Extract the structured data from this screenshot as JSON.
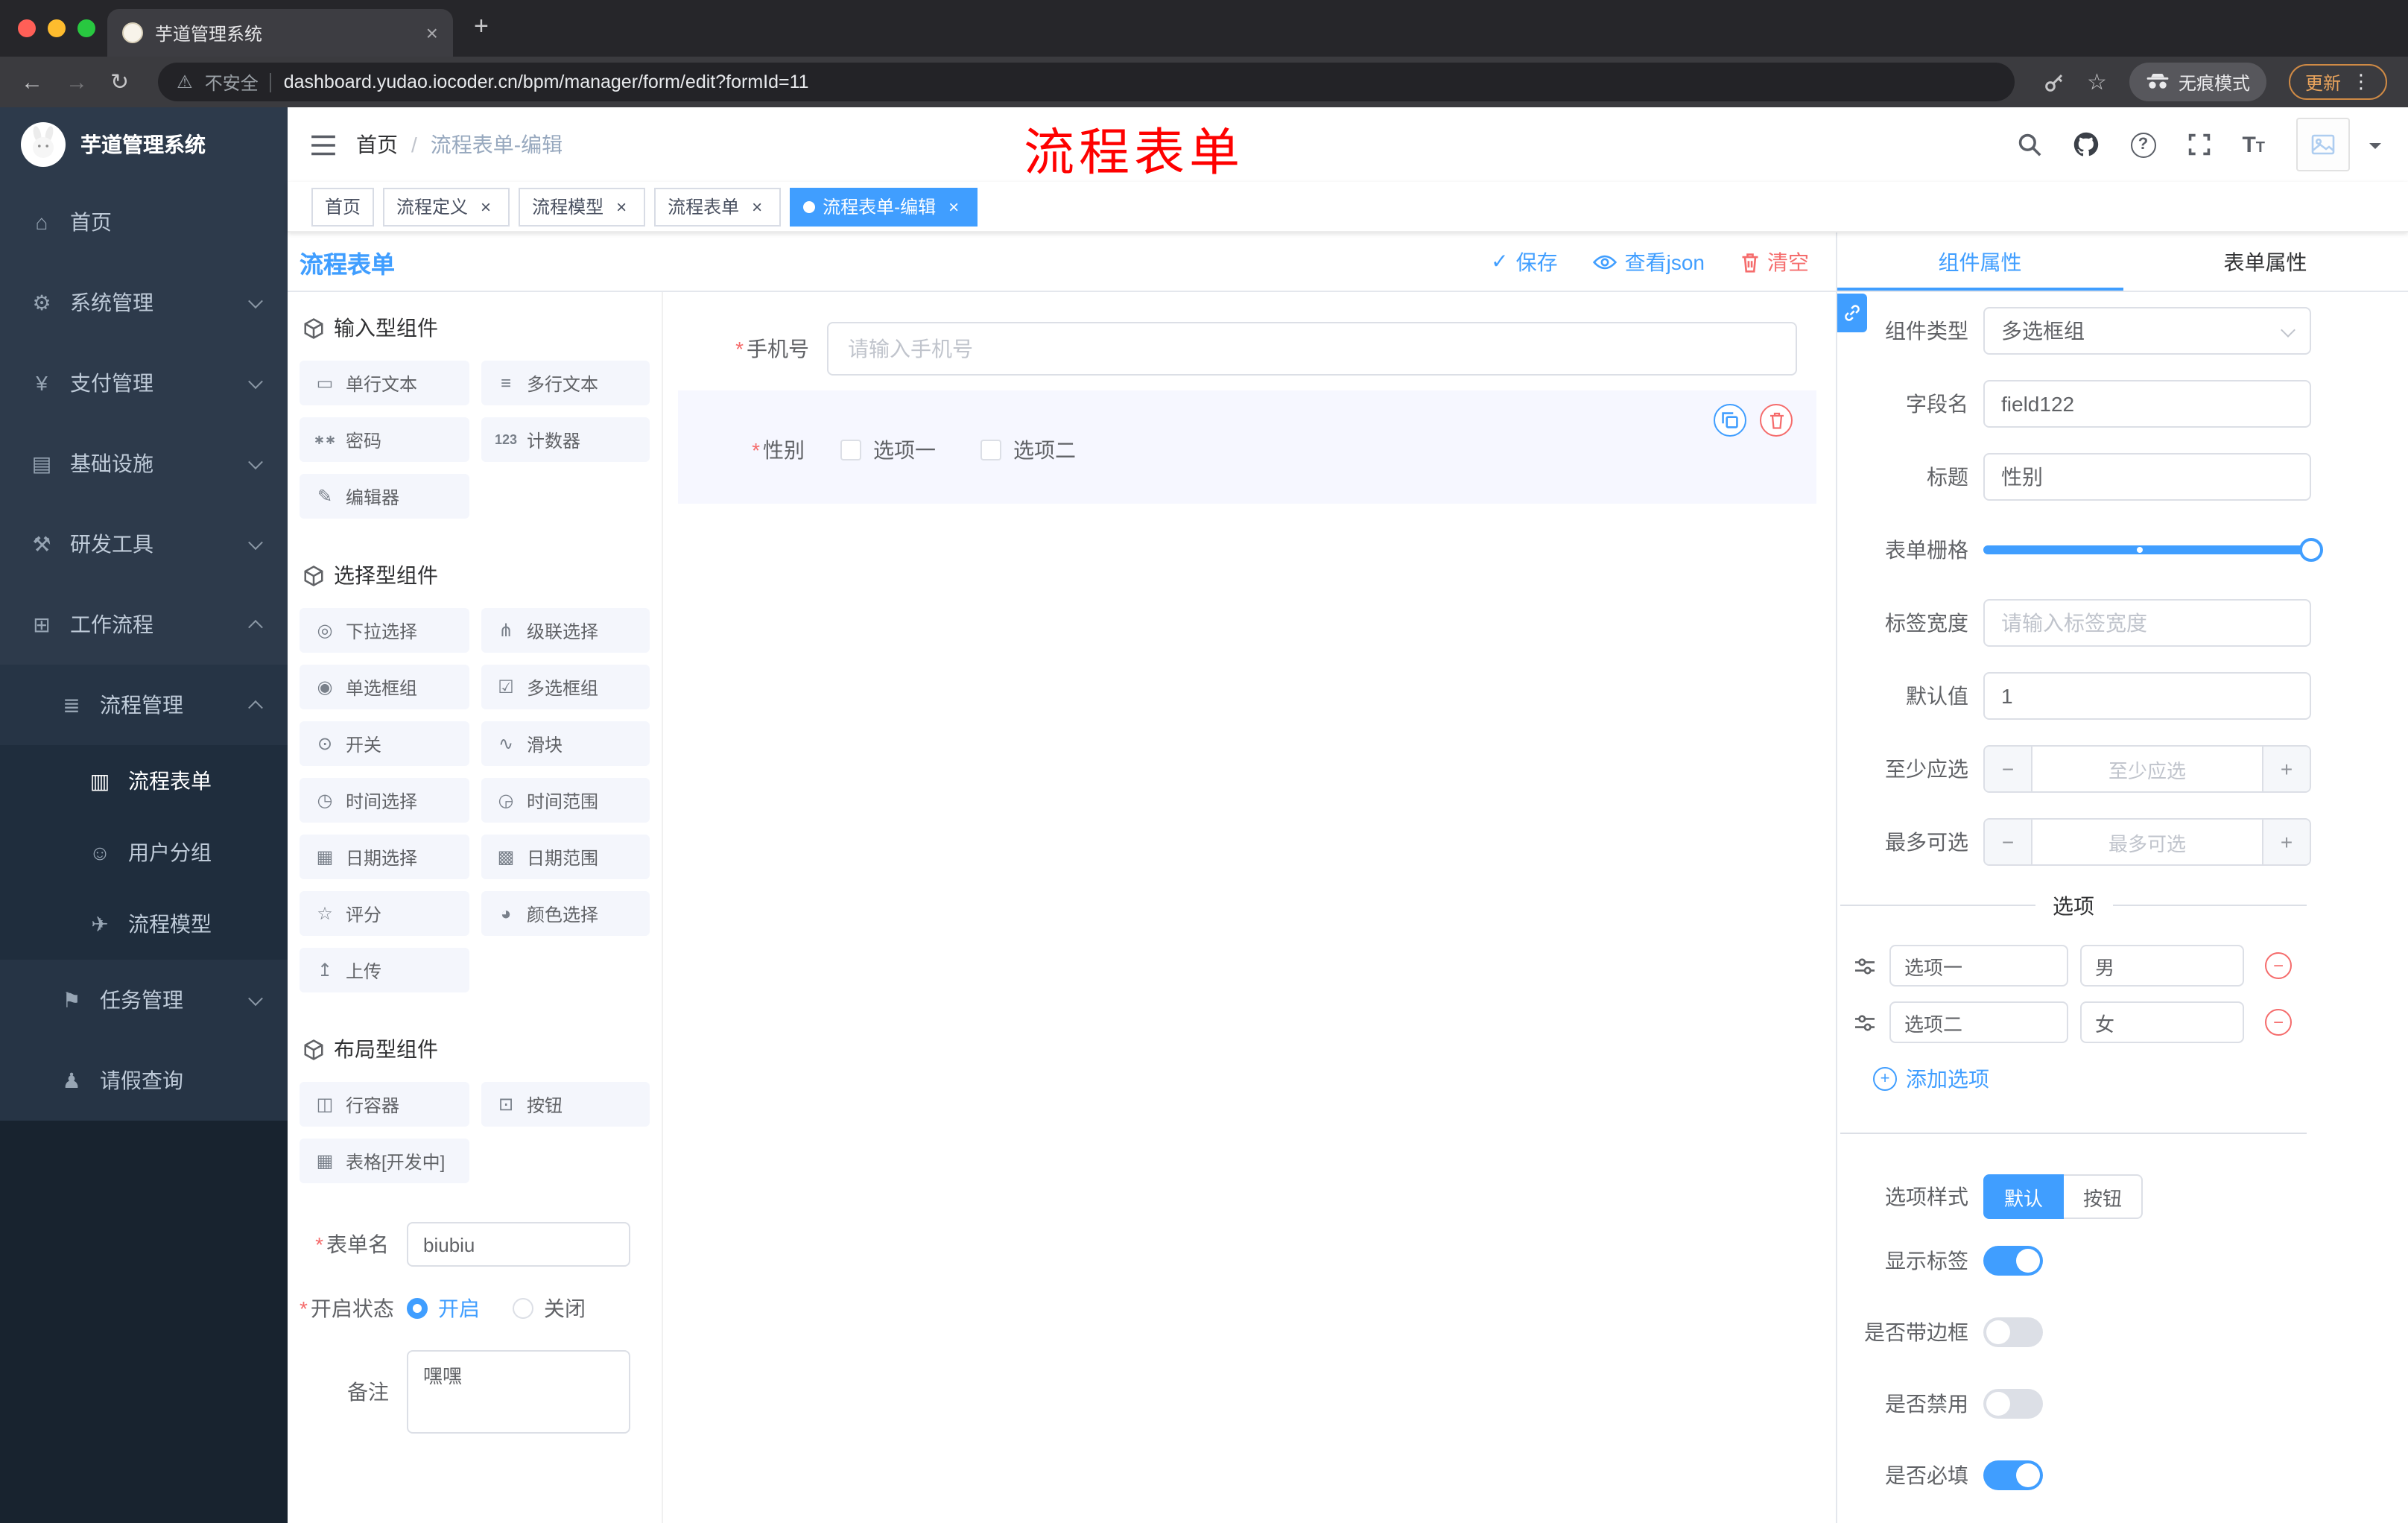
{
  "colors": {
    "accent": "#409EFF",
    "danger": "#F56C6C",
    "sidebar_bg": "#1F2D3D",
    "annotation": "#FF0000"
  },
  "icons": {
    "back": "←",
    "forward": "→",
    "reload": "↻",
    "star": "☆",
    "warning": "⚠",
    "dots": "⋮",
    "plus": "+",
    "close": "×",
    "check": "✓",
    "minus": "−",
    "question": "?",
    "font_large": "T",
    "font_small": "T",
    "home": "⌂",
    "system": "⚙",
    "payment": "¥",
    "infra": "▤",
    "devtool": "⚒",
    "workflow": "⊞",
    "process_mgmt": "≣",
    "process_form": "▥",
    "user_group": "☺",
    "process_model": "✈",
    "task_mgmt": "⚑",
    "leave_query": "♟",
    "single_text": "▭",
    "multi_text": "≡",
    "password": "∗∗",
    "counter": "123",
    "editor": "✎",
    "select": "◎",
    "cascader": "⋔",
    "radio": "◉",
    "checkbox": "☑",
    "switch": "⊙",
    "slider": "∿",
    "time": "◷",
    "time_range": "◶",
    "date": "▦",
    "date_range": "▩",
    "rate": "☆",
    "color": "◕",
    "upload": "↥",
    "row_container": "◫",
    "button": "⊡",
    "table": "▦"
  },
  "browser": {
    "tab_title": "芋道管理系统",
    "security_label": "不安全",
    "url": "dashboard.yudao.iocoder.cn/bpm/manager/form/edit?formId=11",
    "incognito_label": "无痕模式",
    "update_label": "更新"
  },
  "annotation": {
    "text": "流程表单"
  },
  "sidebar": {
    "title": "芋道管理系统",
    "items": [
      {
        "label": "首页"
      },
      {
        "label": "系统管理"
      },
      {
        "label": "支付管理"
      },
      {
        "label": "基础设施"
      },
      {
        "label": "研发工具"
      },
      {
        "label": "工作流程"
      },
      {
        "label": "流程管理"
      },
      {
        "label": "流程表单"
      },
      {
        "label": "用户分组"
      },
      {
        "label": "流程模型"
      },
      {
        "label": "任务管理"
      },
      {
        "label": "请假查询"
      }
    ]
  },
  "header": {
    "breadcrumb_home": "首页",
    "separator": "/",
    "breadcrumb_current": "流程表单-编辑"
  },
  "tags": [
    {
      "label": "首页"
    },
    {
      "label": "流程定义"
    },
    {
      "label": "流程模型"
    },
    {
      "label": "流程表单"
    },
    {
      "label": "流程表单-编辑"
    }
  ],
  "designer": {
    "title": "流程表单",
    "save": "保存",
    "view_json": "查看json",
    "clear": "清空"
  },
  "palette": {
    "group1_title": "输入型组件",
    "group2_title": "选择型组件",
    "group3_title": "布局型组件",
    "input_items": [
      "单行文本",
      "多行文本",
      "密码",
      "计数器",
      "编辑器"
    ],
    "select_items": [
      "下拉选择",
      "级联选择",
      "单选框组",
      "多选框组",
      "开关",
      "滑块",
      "时间选择",
      "时间范围",
      "日期选择",
      "日期范围",
      "评分",
      "颜色选择",
      "上传"
    ],
    "layout_items": [
      "行容器",
      "按钮",
      "表格[开发中]"
    ]
  },
  "form_meta": {
    "name_label": "表单名",
    "name_value": "biubiu",
    "status_label": "开启状态",
    "status_on": "开启",
    "status_off": "关闭",
    "remark_label": "备注",
    "remark_value": "嘿嘿"
  },
  "canvas": {
    "phone_label": "手机号",
    "phone_placeholder": "请输入手机号",
    "gender_label": "性别",
    "gender_option1": "选项一",
    "gender_option2": "选项二"
  },
  "properties": {
    "tab_component": "组件属性",
    "tab_form": "表单属性",
    "component_type_label": "组件类型",
    "component_type_value": "多选框组",
    "field_label": "字段名",
    "field_value": "field122",
    "title_label": "标题",
    "title_value": "性别",
    "grid_label": "表单栅格",
    "label_width_label": "标签宽度",
    "label_width_placeholder": "请输入标签宽度",
    "default_label": "默认值",
    "default_value": "1",
    "min_label": "至少应选",
    "min_placeholder": "至少应选",
    "max_label": "最多可选",
    "max_placeholder": "最多可选",
    "options_title": "选项",
    "options": [
      {
        "label": "选项一",
        "value": "男"
      },
      {
        "label": "选项二",
        "value": "女"
      }
    ],
    "add_option": "添加选项",
    "style_label": "选项样式",
    "style_default": "默认",
    "style_button": "按钮",
    "show_label": "显示标签",
    "border_label": "是否带边框",
    "disabled_label": "是否禁用",
    "required_label": "是否必填"
  }
}
